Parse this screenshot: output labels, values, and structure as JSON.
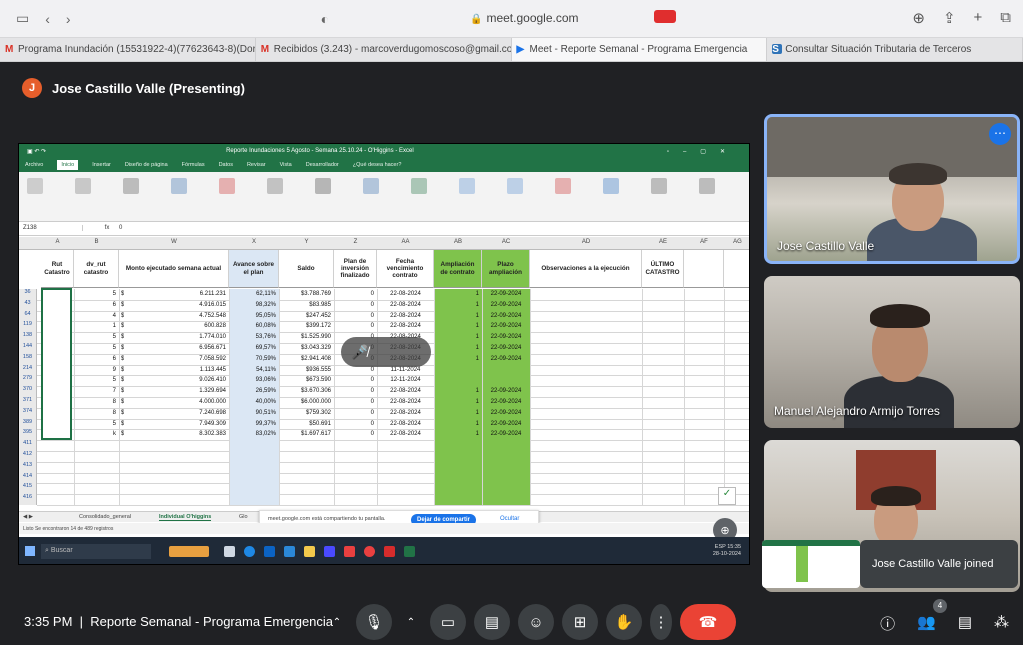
{
  "browser": {
    "url": "meet.google.com",
    "tabs": [
      {
        "icon": "M",
        "label": "Programa Inundación (15531922-4)(77623643-8)(Dori…"
      },
      {
        "icon": "M",
        "label": "Recibidos (3.243) - marcoverdugomoscoso@gmail.co…"
      },
      {
        "icon": "▶",
        "label": "Meet - Reporte Semanal - Programa Emergencia"
      },
      {
        "icon": "S",
        "label": "Consultar Situación Tributaria de Terceros"
      }
    ]
  },
  "meet": {
    "presenter_initial": "J",
    "presenter_label": "Jose Castillo Valle (Presenting)",
    "time": "3:35 PM",
    "meeting_title": "Reporte Semanal - Programa Emergencia",
    "people_count": "4",
    "participants": [
      {
        "name": "Jose Castillo Valle"
      },
      {
        "name": "Manuel Alejandro Armijo Torres"
      }
    ],
    "toast": "Jose Castillo Valle joined"
  },
  "excel": {
    "title": "Reporte Inundaciones 5 Agosto - Semana 25.10.24 - O'Higgins - Excel",
    "menu": [
      "Archivo",
      "Inicio",
      "Insertar",
      "Diseño de página",
      "Fórmulas",
      "Datos",
      "Revisar",
      "Vista",
      "Desarrollador",
      "¿Qué desea hacer?"
    ],
    "namebox": "Z138",
    "formula": "0",
    "columns": [
      {
        "letter": "A",
        "header": "Rut Catastro"
      },
      {
        "letter": "B",
        "header": "dv_rut catastro"
      },
      {
        "letter": "W",
        "header": "Monto ejecutado semana actual"
      },
      {
        "letter": "X",
        "header": "Avance sobre el plan"
      },
      {
        "letter": "Y",
        "header": "Saldo"
      },
      {
        "letter": "Z",
        "header": "Plan de inversión finalizado"
      },
      {
        "letter": "AA",
        "header": "Fecha vencimiento contrato"
      },
      {
        "letter": "AB",
        "header": "Ampliación de contrato"
      },
      {
        "letter": "AC",
        "header": "Plazo ampliación"
      },
      {
        "letter": "AD",
        "header": "Observaciones a la ejecución"
      },
      {
        "letter": "AE",
        "header": "ÚLTIMO CATASTRO"
      },
      {
        "letter": "AF",
        "header": ""
      },
      {
        "letter": "AG",
        "header": ""
      }
    ],
    "rows": [
      {
        "n": "36",
        "dv": "5",
        "monto": "6.211.231",
        "avance": "62,11%",
        "saldo": "$3.788.769",
        "plan": "0",
        "fecha": "22-08-2024",
        "amp": "1",
        "plazo": "22-09-2024"
      },
      {
        "n": "43",
        "dv": "6",
        "monto": "4.916.015",
        "avance": "98,32%",
        "saldo": "$83.985",
        "plan": "0",
        "fecha": "22-08-2024",
        "amp": "1",
        "plazo": "22-09-2024"
      },
      {
        "n": "64",
        "dv": "4",
        "monto": "4.752.548",
        "avance": "95,05%",
        "saldo": "$247.452",
        "plan": "0",
        "fecha": "22-08-2024",
        "amp": "1",
        "plazo": "22-09-2024"
      },
      {
        "n": "119",
        "dv": "1",
        "monto": "600.828",
        "avance": "60,08%",
        "saldo": "$399.172",
        "plan": "0",
        "fecha": "22-08-2024",
        "amp": "1",
        "plazo": "22-09-2024"
      },
      {
        "n": "138",
        "dv": "5",
        "monto": "1.774.010",
        "avance": "53,76%",
        "saldo": "$1.525.990",
        "plan": "0",
        "fecha": "22-08-2024",
        "amp": "1",
        "plazo": "22-09-2024"
      },
      {
        "n": "144",
        "dv": "5",
        "monto": "6.956.671",
        "avance": "69,57%",
        "saldo": "$3.043.329",
        "plan": "0",
        "fecha": "22-08-2024",
        "amp": "1",
        "plazo": "22-09-2024"
      },
      {
        "n": "158",
        "dv": "6",
        "monto": "7.058.592",
        "avance": "70,59%",
        "saldo": "$2.941.408",
        "plan": "0",
        "fecha": "22-08-2024",
        "amp": "1",
        "plazo": "22-09-2024"
      },
      {
        "n": "214",
        "dv": "9",
        "monto": "1.113.445",
        "avance": "54,11%",
        "saldo": "$936.555",
        "plan": "0",
        "fecha": "11-11-2024",
        "amp": "",
        "plazo": ""
      },
      {
        "n": "279",
        "dv": "5",
        "monto": "9.026.410",
        "avance": "93,06%",
        "saldo": "$673.590",
        "plan": "0",
        "fecha": "12-11-2024",
        "amp": "",
        "plazo": ""
      },
      {
        "n": "370",
        "dv": "7",
        "monto": "1.329.694",
        "avance": "26,59%",
        "saldo": "$3.670.306",
        "plan": "0",
        "fecha": "22-08-2024",
        "amp": "1",
        "plazo": "22-09-2024"
      },
      {
        "n": "371",
        "dv": "8",
        "monto": "4.000.000",
        "avance": "40,00%",
        "saldo": "$6.000.000",
        "plan": "0",
        "fecha": "22-08-2024",
        "amp": "1",
        "plazo": "22-09-2024"
      },
      {
        "n": "374",
        "dv": "8",
        "monto": "7.240.698",
        "avance": "90,51%",
        "saldo": "$759.302",
        "plan": "0",
        "fecha": "22-08-2024",
        "amp": "1",
        "plazo": "22-09-2024"
      },
      {
        "n": "389",
        "dv": "5",
        "monto": "7.949.309",
        "avance": "99,37%",
        "saldo": "$50.691",
        "plan": "0",
        "fecha": "22-08-2024",
        "amp": "1",
        "plazo": "22-09-2024"
      },
      {
        "n": "395",
        "dv": "k",
        "monto": "8.302.383",
        "avance": "83,02%",
        "saldo": "$1.697.617",
        "plan": "0",
        "fecha": "22-08-2024",
        "amp": "1",
        "plazo": "22-09-2024"
      }
    ],
    "empty_rows": [
      "411",
      "412",
      "413",
      "414",
      "415",
      "416"
    ],
    "sheet_tabs": [
      "Consolidado_general",
      "Individual O'higgins",
      "Glo"
    ],
    "status": "Listo    Se encontraron 14 de 489 registros",
    "share_banner": "meet.google.com está compartiendo tu pantalla.",
    "stop_share": "Dejar de compartir",
    "hide": "Ocultar",
    "taskbar_search": "Buscar",
    "taskbar_time": "15:35",
    "taskbar_date": "28-10-2024",
    "taskbar_lang": "ESP"
  }
}
